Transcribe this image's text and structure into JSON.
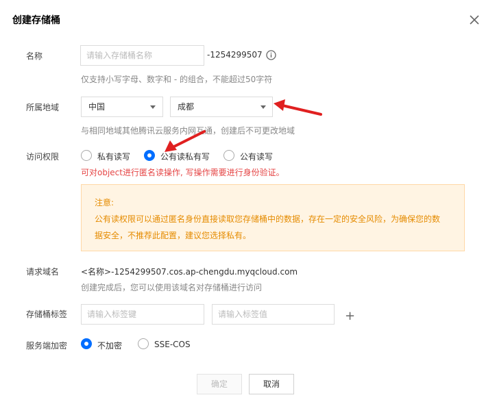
{
  "dialog": {
    "title": "创建存储桶"
  },
  "form": {
    "name": {
      "label": "名称",
      "placeholder": "请输入存储桶名称",
      "suffix": "-1254299507",
      "hint": "仅支持小写字母、数字和 - 的组合，不能超过50字符"
    },
    "region": {
      "label": "所属地域",
      "country": "中国",
      "city": "成都",
      "hint": "与相同地域其他腾讯云服务内网互通，创建后不可更改地域"
    },
    "access": {
      "label": "访问权限",
      "options": [
        "私有读写",
        "公有读私有写",
        "公有读写"
      ],
      "selected": "公有读私有写",
      "warning": "可对object进行匿名读操作, 写操作需要进行身份验证。",
      "notice_title": "注意:",
      "notice_line1": "公有读权限可以通过匿名身份直接读取您存储桶中的数据，存在一定的安全风险，为确保您的数",
      "notice_line2": "据安全，不推荐此配置，建议您选择私有。"
    },
    "domain": {
      "label": "请求域名",
      "value": "<名称>-1254299507.cos.ap-chengdu.myqcloud.com",
      "hint": "创建完成后，您可以使用该域名对存储桶进行访问"
    },
    "tags": {
      "label": "存储桶标签",
      "key_placeholder": "请输入标签键",
      "value_placeholder": "请输入标签值",
      "add_symbol": "+"
    },
    "encryption": {
      "label": "服务端加密",
      "options": [
        "不加密",
        "SSE-COS"
      ],
      "selected": "不加密"
    }
  },
  "footer": {
    "confirm": "确定",
    "cancel": "取消"
  },
  "colors": {
    "accent": "#006eff",
    "warning_text": "#e54545",
    "notice_bg": "#fff4e3",
    "notice_border": "#ffd8a6",
    "notice_text": "#e58b00",
    "annotation_arrow": "#e02020"
  }
}
